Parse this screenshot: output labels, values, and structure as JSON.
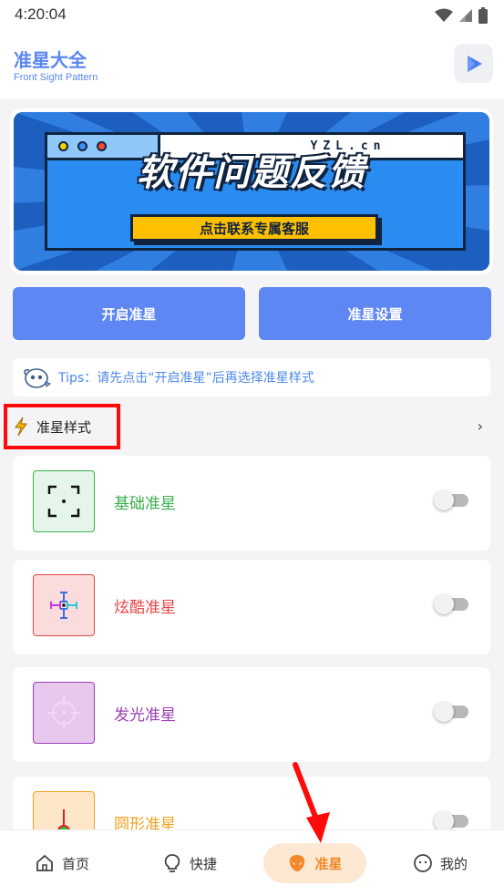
{
  "status_bar": {
    "time": "4:20:04"
  },
  "app": {
    "title": "准星大全",
    "subtitle": "Front Sight Pattern"
  },
  "banner": {
    "url_text": "YZL.cn",
    "headline": "软件问题反馈",
    "cta": "点击联系专属客服"
  },
  "actions": {
    "open_label": "开启准星",
    "settings_label": "准星设置"
  },
  "tips": {
    "text": "Tips：请先点击“开启准星”后再选择准星样式"
  },
  "section": {
    "title": "准星样式",
    "chevron": "›"
  },
  "styles": [
    {
      "name": "基础准星",
      "color": "#3bb04b",
      "enabled": false
    },
    {
      "name": "炫酷准星",
      "color": "#e54848",
      "enabled": false
    },
    {
      "name": "发光准星",
      "color": "#9b3fb5",
      "enabled": false
    },
    {
      "name": "圆形准星",
      "color": "#f0a020",
      "enabled": false
    }
  ],
  "nav": {
    "home": "首页",
    "quick": "快捷",
    "aim": "准星",
    "mine": "我的",
    "active": "准星"
  },
  "colors": {
    "accent": "#5e87f4",
    "highlight": "#ff0a0a",
    "nav_active": "#f08a2a"
  }
}
